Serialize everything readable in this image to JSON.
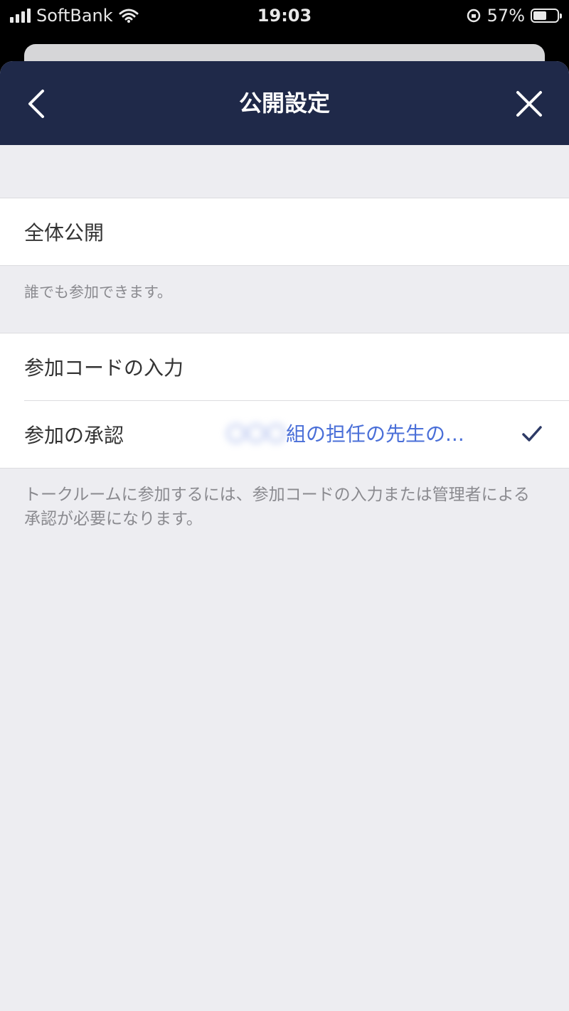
{
  "status": {
    "carrier": "SoftBank",
    "time": "19:03",
    "battery_text": "57%",
    "battery_level": 0.57
  },
  "nav": {
    "title": "公開設定"
  },
  "section1": {
    "option_public": "全体公開",
    "note": "誰でも参加できます。"
  },
  "section2": {
    "option_code": "参加コードの入力",
    "option_approval": "参加の承認",
    "approval_value_blurred": "〇〇〇",
    "approval_value": "組の担任の先生の...",
    "note": "トークルームに参加するには、参加コードの入力または管理者による承認が必要になります。"
  },
  "colors": {
    "nav_bg": "#1f2949",
    "accent": "#4a6fd8",
    "check": "#2d3a66"
  },
  "icons": [
    "signal-icon",
    "wifi-icon",
    "orientation-lock-icon",
    "battery-icon",
    "back-chevron-icon",
    "close-icon",
    "checkmark-icon"
  ]
}
